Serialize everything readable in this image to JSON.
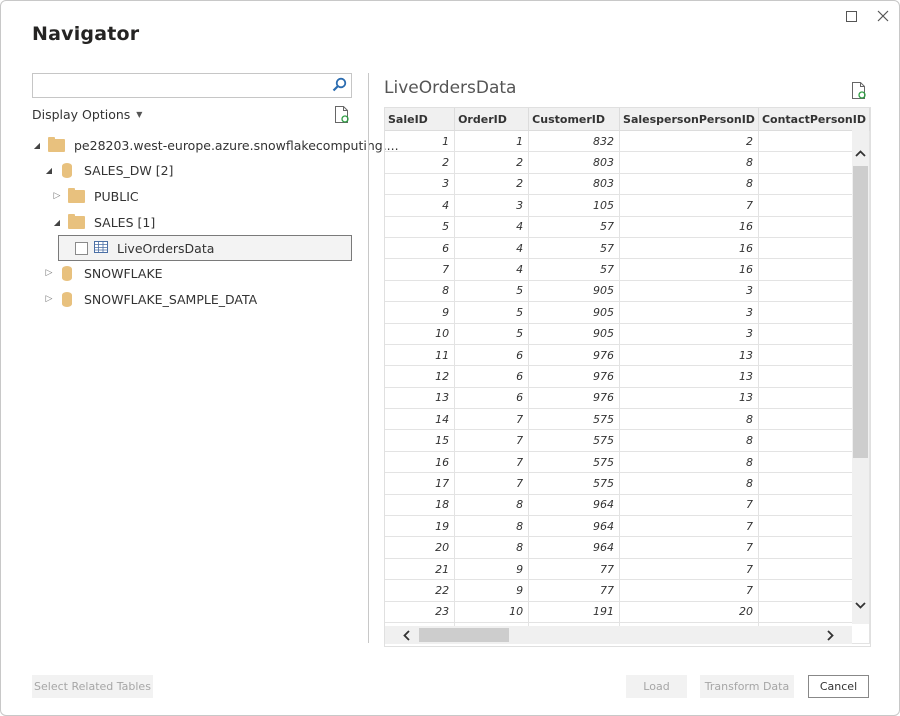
{
  "window": {
    "title": "Navigator",
    "maximize_icon": "maximize-icon",
    "close_icon": "close-icon"
  },
  "left": {
    "search": {
      "value": "",
      "placeholder": "",
      "icon": "search-icon"
    },
    "display_options": "Display Options",
    "refresh_icon": "refresh-icon",
    "tree": [
      {
        "label": "pe28203.west-europe.azure.snowflakecomputing....",
        "type": "server",
        "state": "expanded",
        "icon": "folder-icon"
      },
      {
        "label": "SALES_DW [2]",
        "type": "database",
        "state": "expanded",
        "icon": "database-icon"
      },
      {
        "label": "PUBLIC",
        "type": "schema",
        "state": "collapsed",
        "icon": "folder-icon"
      },
      {
        "label": "SALES [1]",
        "type": "schema",
        "state": "expanded",
        "icon": "folder-icon"
      },
      {
        "label": "LiveOrdersData",
        "type": "table",
        "checked": false,
        "selected": true,
        "icon": "table-icon"
      },
      {
        "label": "SNOWFLAKE",
        "type": "database",
        "state": "collapsed",
        "icon": "database-icon"
      },
      {
        "label": "SNOWFLAKE_SAMPLE_DATA",
        "type": "database",
        "state": "collapsed",
        "icon": "database-icon"
      }
    ]
  },
  "preview": {
    "title": "LiveOrdersData",
    "refresh_icon": "refresh-icon",
    "columns": [
      "SaleID",
      "OrderID",
      "CustomerID",
      "SalespersonPersonID",
      "ContactPersonID"
    ],
    "rows": [
      [
        1,
        1,
        832,
        2,
        ""
      ],
      [
        2,
        2,
        803,
        8,
        ""
      ],
      [
        3,
        2,
        803,
        8,
        ""
      ],
      [
        4,
        3,
        105,
        7,
        ""
      ],
      [
        5,
        4,
        57,
        16,
        ""
      ],
      [
        6,
        4,
        57,
        16,
        ""
      ],
      [
        7,
        4,
        57,
        16,
        ""
      ],
      [
        8,
        5,
        905,
        3,
        ""
      ],
      [
        9,
        5,
        905,
        3,
        ""
      ],
      [
        10,
        5,
        905,
        3,
        ""
      ],
      [
        11,
        6,
        976,
        13,
        ""
      ],
      [
        12,
        6,
        976,
        13,
        ""
      ],
      [
        13,
        6,
        976,
        13,
        ""
      ],
      [
        14,
        7,
        575,
        8,
        ""
      ],
      [
        15,
        7,
        575,
        8,
        ""
      ],
      [
        16,
        7,
        575,
        8,
        ""
      ],
      [
        17,
        7,
        575,
        8,
        ""
      ],
      [
        18,
        8,
        964,
        7,
        ""
      ],
      [
        19,
        8,
        964,
        7,
        ""
      ],
      [
        20,
        8,
        964,
        7,
        ""
      ],
      [
        21,
        9,
        77,
        7,
        ""
      ],
      [
        22,
        9,
        77,
        7,
        ""
      ],
      [
        23,
        10,
        191,
        20,
        ""
      ],
      [
        "",
        "",
        "",
        "",
        ""
      ]
    ]
  },
  "footer": {
    "select_related": "Select Related Tables",
    "load": "Load",
    "transform": "Transform Data",
    "cancel": "Cancel"
  }
}
